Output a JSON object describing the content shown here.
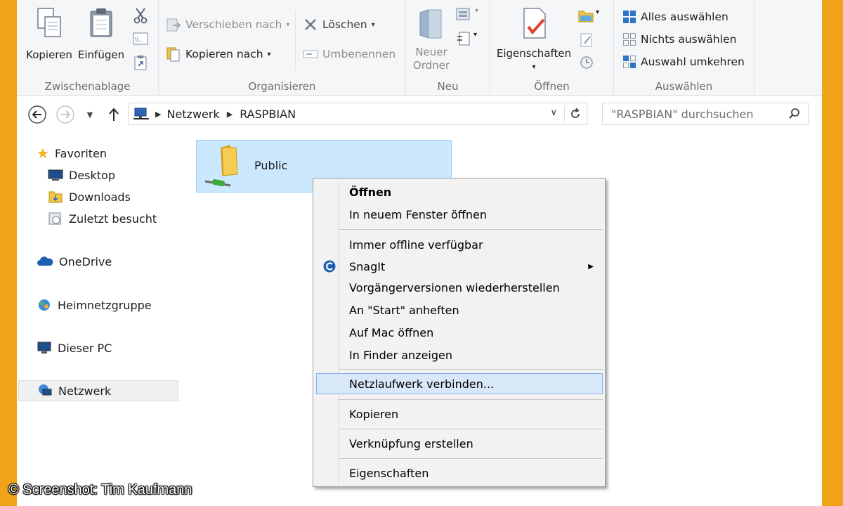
{
  "ribbon": {
    "clipboard": {
      "label": "Zwischenablage",
      "copy": "Kopieren",
      "paste": "Einfügen"
    },
    "organize": {
      "label": "Organisieren",
      "move_to": "Verschieben nach",
      "copy_to": "Kopieren nach",
      "delete": "Löschen",
      "rename": "Umbenennen"
    },
    "new": {
      "label": "Neu",
      "new_folder_line1": "Neuer",
      "new_folder_line2": "Ordner"
    },
    "open": {
      "label": "Öffnen",
      "properties": "Eigenschaften"
    },
    "select": {
      "label": "Auswählen",
      "select_all": "Alles auswählen",
      "select_none": "Nichts auswählen",
      "invert": "Auswahl umkehren"
    }
  },
  "address": {
    "crumbs": [
      "Netzwerk",
      "RASPBIAN"
    ],
    "search_placeholder": "\"RASPBIAN\" durchsuchen"
  },
  "nav": {
    "favorites": "Favoriten",
    "desktop": "Desktop",
    "downloads": "Downloads",
    "recent": "Zuletzt besucht",
    "onedrive": "OneDrive",
    "homegroup": "Heimnetzgruppe",
    "this_pc": "Dieser PC",
    "network": "Netzwerk"
  },
  "content": {
    "folder_name": "Public"
  },
  "context_menu": {
    "items": [
      "Öffnen",
      "In neuem Fenster öffnen",
      "Immer offline verfügbar",
      "SnagIt",
      "Vorgängerversionen wiederherstellen",
      "An \"Start\" anheften",
      "Auf Mac öffnen",
      "In Finder anzeigen",
      "Netzlaufwerk verbinden...",
      "Kopieren",
      "Verknüpfung erstellen",
      "Eigenschaften"
    ],
    "highlighted": "Netzlaufwerk verbinden..."
  },
  "watermark": "© Screenshot: Tim Kaufmann",
  "colors": {
    "accent_frame": "#f7b52d",
    "selection_bg": "#cce8ff",
    "menu_highlight": "#d9e8f9"
  }
}
